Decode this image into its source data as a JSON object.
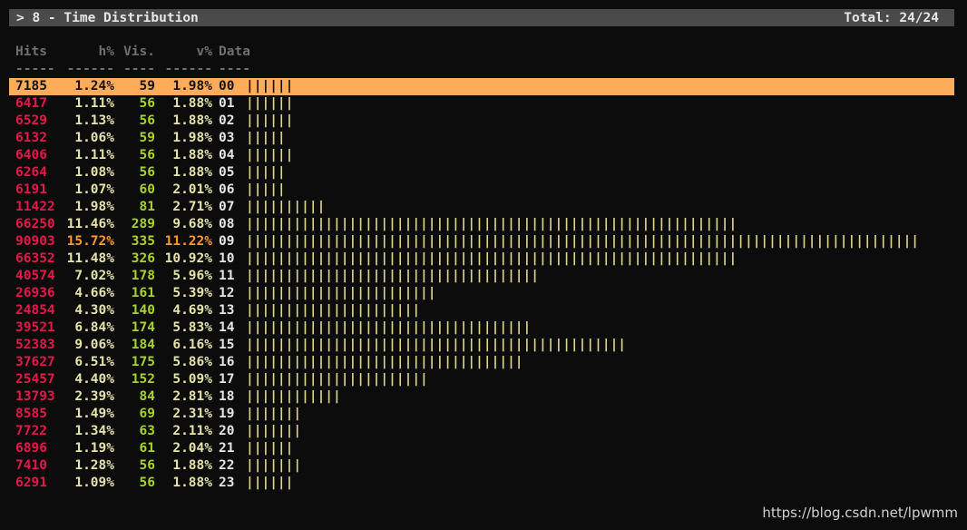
{
  "panel": {
    "title": "> 8 - Time Distribution",
    "total": "Total: 24/24"
  },
  "columns": {
    "hits": "Hits",
    "h_pct": "h%",
    "visitors": "Vis.",
    "v_pct": "v%",
    "data": "Data"
  },
  "underline": {
    "hits": "-----",
    "h_pct": "------",
    "visitors": "----",
    "v_pct": "------",
    "data": "----"
  },
  "rows": [
    {
      "hits": "7185",
      "h_pct": "1.24%",
      "visitors": "59",
      "v_pct": "1.98%",
      "data": "00",
      "bars": "||||||"
    },
    {
      "hits": "6417",
      "h_pct": "1.11%",
      "visitors": "56",
      "v_pct": "1.88%",
      "data": "01",
      "bars": "||||||"
    },
    {
      "hits": "6529",
      "h_pct": "1.13%",
      "visitors": "56",
      "v_pct": "1.88%",
      "data": "02",
      "bars": "||||||"
    },
    {
      "hits": "6132",
      "h_pct": "1.06%",
      "visitors": "59",
      "v_pct": "1.98%",
      "data": "03",
      "bars": "|||||"
    },
    {
      "hits": "6406",
      "h_pct": "1.11%",
      "visitors": "56",
      "v_pct": "1.88%",
      "data": "04",
      "bars": "||||||"
    },
    {
      "hits": "6264",
      "h_pct": "1.08%",
      "visitors": "56",
      "v_pct": "1.88%",
      "data": "05",
      "bars": "|||||"
    },
    {
      "hits": "6191",
      "h_pct": "1.07%",
      "visitors": "60",
      "v_pct": "2.01%",
      "data": "06",
      "bars": "|||||"
    },
    {
      "hits": "11422",
      "h_pct": "1.98%",
      "visitors": "81",
      "v_pct": "2.71%",
      "data": "07",
      "bars": "||||||||||"
    },
    {
      "hits": "66250",
      "h_pct": "11.46%",
      "visitors": "289",
      "v_pct": "9.68%",
      "data": "08",
      "bars": "||||||||||||||||||||||||||||||||||||||||||||||||||||||||||||||"
    },
    {
      "hits": "90903",
      "h_pct": "15.72%",
      "visitors": "335",
      "v_pct": "11.22%",
      "data": "09",
      "bars": "|||||||||||||||||||||||||||||||||||||||||||||||||||||||||||||||||||||||||||||||||||||"
    },
    {
      "hits": "66352",
      "h_pct": "11.48%",
      "visitors": "326",
      "v_pct": "10.92%",
      "data": "10",
      "bars": "||||||||||||||||||||||||||||||||||||||||||||||||||||||||||||||"
    },
    {
      "hits": "40574",
      "h_pct": "7.02%",
      "visitors": "178",
      "v_pct": "5.96%",
      "data": "11",
      "bars": "|||||||||||||||||||||||||||||||||||||"
    },
    {
      "hits": "26936",
      "h_pct": "4.66%",
      "visitors": "161",
      "v_pct": "5.39%",
      "data": "12",
      "bars": "||||||||||||||||||||||||"
    },
    {
      "hits": "24854",
      "h_pct": "4.30%",
      "visitors": "140",
      "v_pct": "4.69%",
      "data": "13",
      "bars": "||||||||||||||||||||||"
    },
    {
      "hits": "39521",
      "h_pct": "6.84%",
      "visitors": "174",
      "v_pct": "5.83%",
      "data": "14",
      "bars": "||||||||||||||||||||||||||||||||||||"
    },
    {
      "hits": "52383",
      "h_pct": "9.06%",
      "visitors": "184",
      "v_pct": "6.16%",
      "data": "15",
      "bars": "||||||||||||||||||||||||||||||||||||||||||||||||"
    },
    {
      "hits": "37627",
      "h_pct": "6.51%",
      "visitors": "175",
      "v_pct": "5.86%",
      "data": "16",
      "bars": "|||||||||||||||||||||||||||||||||||"
    },
    {
      "hits": "25457",
      "h_pct": "4.40%",
      "visitors": "152",
      "v_pct": "5.09%",
      "data": "17",
      "bars": "|||||||||||||||||||||||"
    },
    {
      "hits": "13793",
      "h_pct": "2.39%",
      "visitors": "84",
      "v_pct": "2.81%",
      "data": "18",
      "bars": "||||||||||||"
    },
    {
      "hits": "8585",
      "h_pct": "1.49%",
      "visitors": "69",
      "v_pct": "2.31%",
      "data": "19",
      "bars": "|||||||"
    },
    {
      "hits": "7722",
      "h_pct": "1.34%",
      "visitors": "63",
      "v_pct": "2.11%",
      "data": "20",
      "bars": "|||||||"
    },
    {
      "hits": "6896",
      "h_pct": "1.19%",
      "visitors": "61",
      "v_pct": "2.04%",
      "data": "21",
      "bars": "||||||"
    },
    {
      "hits": "7410",
      "h_pct": "1.28%",
      "visitors": "56",
      "v_pct": "1.88%",
      "data": "22",
      "bars": "|||||||"
    },
    {
      "hits": "6291",
      "h_pct": "1.09%",
      "visitors": "56",
      "v_pct": "1.88%",
      "data": "23",
      "bars": "||||||"
    }
  ],
  "watermark": "https://blog.csdn.net/lpwmm",
  "colors": {
    "hits": "#e8174a",
    "percent": "#e6e3a8",
    "visitors": "#a8d42a",
    "peak_percent": "#ff9a2e",
    "selected_row": "#ffab5c",
    "header_bar": "#4a4a4a"
  }
}
